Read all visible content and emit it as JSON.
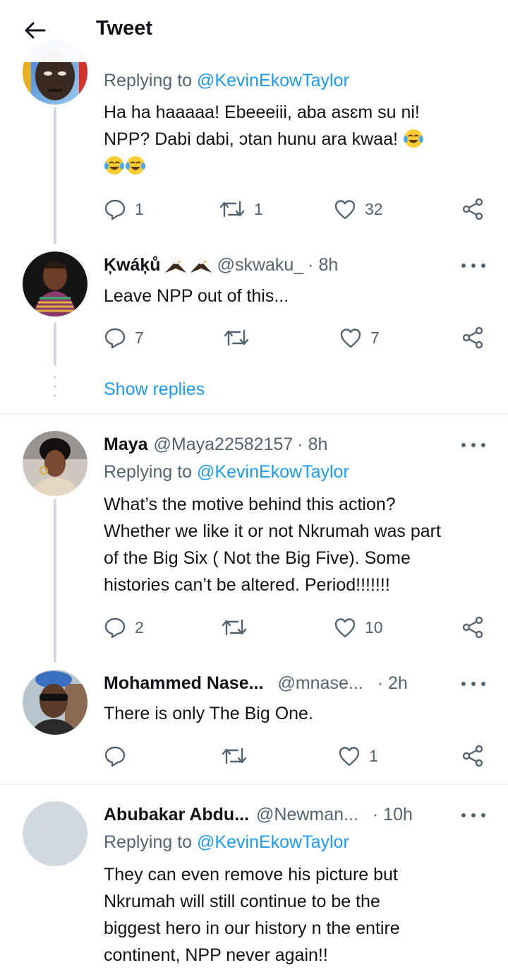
{
  "header": {
    "title": "Tweet"
  },
  "tweets": [
    {
      "replying_prefix": "Replying to",
      "replying_handle": "@KevinEkowTaylor",
      "text_lines": [
        "Ha ha haaaaa! Ebeeeiii, aba asɛm su ni!",
        "NPP? Dabi dabi, ɔtan hunu ara kwaa!"
      ],
      "reply_count": "1",
      "retweet_count": "1",
      "like_count": "32"
    },
    {
      "name": "Ķwáķů",
      "handle": "@skwaku_",
      "time": "· 8h",
      "text_lines": [
        "Leave NPP out of this..."
      ],
      "reply_count": "7",
      "retweet_count": "",
      "like_count": "7",
      "show_replies": "Show replies"
    },
    {
      "name": "Maya",
      "handle": "@Maya22582157",
      "time": "· 8h",
      "replying_prefix": "Replying to",
      "replying_handle": "@KevinEkowTaylor",
      "text_lines": [
        "What’s the motive behind this action?",
        "Whether we like it or not Nkrumah was part",
        "of the Big Six ( Not the Big Five). Some",
        "histories can’t be altered. Period!!!!!!!"
      ],
      "reply_count": "2",
      "retweet_count": "",
      "like_count": "10"
    },
    {
      "name": "Mohammed Nase...",
      "handle": "@mnase...",
      "time": "· 2h",
      "text_lines": [
        "There is only The Big One."
      ],
      "reply_count": "",
      "retweet_count": "",
      "like_count": "1"
    },
    {
      "name": "Abubakar Abdu...",
      "handle": "@Newman...",
      "time": "· 10h",
      "replying_prefix": "Replying to",
      "replying_handle": "@KevinEkowTaylor",
      "text_lines": [
        "They can even remove his picture but",
        "Nkrumah will still continue to be the",
        "biggest hero in our history n the entire",
        "continent, NPP never again!!"
      ]
    }
  ],
  "icons": {
    "back": "arrow-left-icon",
    "reply": "reply-icon",
    "retweet": "retweet-icon",
    "like": "heart-icon",
    "share": "share-icon",
    "more": "more-icon",
    "emoji": "tears-of-joy-emoji",
    "eagle": "eagle-emoji"
  },
  "colors": {
    "accent": "#1d9bf0",
    "secondary_text": "#536471",
    "text": "#0f1419",
    "thread_line": "#cfd9de"
  }
}
